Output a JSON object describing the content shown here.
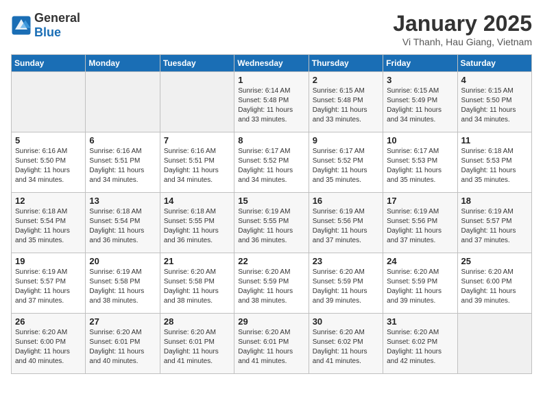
{
  "logo": {
    "general": "General",
    "blue": "Blue"
  },
  "title": "January 2025",
  "location": "Vi Thanh, Hau Giang, Vietnam",
  "weekdays": [
    "Sunday",
    "Monday",
    "Tuesday",
    "Wednesday",
    "Thursday",
    "Friday",
    "Saturday"
  ],
  "weeks": [
    [
      {
        "day": "",
        "info": ""
      },
      {
        "day": "",
        "info": ""
      },
      {
        "day": "",
        "info": ""
      },
      {
        "day": "1",
        "sunrise": "6:14 AM",
        "sunset": "5:48 PM",
        "daylight": "11 hours and 33 minutes."
      },
      {
        "day": "2",
        "sunrise": "6:15 AM",
        "sunset": "5:48 PM",
        "daylight": "11 hours and 33 minutes."
      },
      {
        "day": "3",
        "sunrise": "6:15 AM",
        "sunset": "5:49 PM",
        "daylight": "11 hours and 34 minutes."
      },
      {
        "day": "4",
        "sunrise": "6:15 AM",
        "sunset": "5:50 PM",
        "daylight": "11 hours and 34 minutes."
      }
    ],
    [
      {
        "day": "5",
        "sunrise": "6:16 AM",
        "sunset": "5:50 PM",
        "daylight": "11 hours and 34 minutes."
      },
      {
        "day": "6",
        "sunrise": "6:16 AM",
        "sunset": "5:51 PM",
        "daylight": "11 hours and 34 minutes."
      },
      {
        "day": "7",
        "sunrise": "6:16 AM",
        "sunset": "5:51 PM",
        "daylight": "11 hours and 34 minutes."
      },
      {
        "day": "8",
        "sunrise": "6:17 AM",
        "sunset": "5:52 PM",
        "daylight": "11 hours and 34 minutes."
      },
      {
        "day": "9",
        "sunrise": "6:17 AM",
        "sunset": "5:52 PM",
        "daylight": "11 hours and 35 minutes."
      },
      {
        "day": "10",
        "sunrise": "6:17 AM",
        "sunset": "5:53 PM",
        "daylight": "11 hours and 35 minutes."
      },
      {
        "day": "11",
        "sunrise": "6:18 AM",
        "sunset": "5:53 PM",
        "daylight": "11 hours and 35 minutes."
      }
    ],
    [
      {
        "day": "12",
        "sunrise": "6:18 AM",
        "sunset": "5:54 PM",
        "daylight": "11 hours and 35 minutes."
      },
      {
        "day": "13",
        "sunrise": "6:18 AM",
        "sunset": "5:54 PM",
        "daylight": "11 hours and 36 minutes."
      },
      {
        "day": "14",
        "sunrise": "6:18 AM",
        "sunset": "5:55 PM",
        "daylight": "11 hours and 36 minutes."
      },
      {
        "day": "15",
        "sunrise": "6:19 AM",
        "sunset": "5:55 PM",
        "daylight": "11 hours and 36 minutes."
      },
      {
        "day": "16",
        "sunrise": "6:19 AM",
        "sunset": "5:56 PM",
        "daylight": "11 hours and 37 minutes."
      },
      {
        "day": "17",
        "sunrise": "6:19 AM",
        "sunset": "5:56 PM",
        "daylight": "11 hours and 37 minutes."
      },
      {
        "day": "18",
        "sunrise": "6:19 AM",
        "sunset": "5:57 PM",
        "daylight": "11 hours and 37 minutes."
      }
    ],
    [
      {
        "day": "19",
        "sunrise": "6:19 AM",
        "sunset": "5:57 PM",
        "daylight": "11 hours and 37 minutes."
      },
      {
        "day": "20",
        "sunrise": "6:19 AM",
        "sunset": "5:58 PM",
        "daylight": "11 hours and 38 minutes."
      },
      {
        "day": "21",
        "sunrise": "6:20 AM",
        "sunset": "5:58 PM",
        "daylight": "11 hours and 38 minutes."
      },
      {
        "day": "22",
        "sunrise": "6:20 AM",
        "sunset": "5:59 PM",
        "daylight": "11 hours and 38 minutes."
      },
      {
        "day": "23",
        "sunrise": "6:20 AM",
        "sunset": "5:59 PM",
        "daylight": "11 hours and 39 minutes."
      },
      {
        "day": "24",
        "sunrise": "6:20 AM",
        "sunset": "5:59 PM",
        "daylight": "11 hours and 39 minutes."
      },
      {
        "day": "25",
        "sunrise": "6:20 AM",
        "sunset": "6:00 PM",
        "daylight": "11 hours and 39 minutes."
      }
    ],
    [
      {
        "day": "26",
        "sunrise": "6:20 AM",
        "sunset": "6:00 PM",
        "daylight": "11 hours and 40 minutes."
      },
      {
        "day": "27",
        "sunrise": "6:20 AM",
        "sunset": "6:01 PM",
        "daylight": "11 hours and 40 minutes."
      },
      {
        "day": "28",
        "sunrise": "6:20 AM",
        "sunset": "6:01 PM",
        "daylight": "11 hours and 41 minutes."
      },
      {
        "day": "29",
        "sunrise": "6:20 AM",
        "sunset": "6:01 PM",
        "daylight": "11 hours and 41 minutes."
      },
      {
        "day": "30",
        "sunrise": "6:20 AM",
        "sunset": "6:02 PM",
        "daylight": "11 hours and 41 minutes."
      },
      {
        "day": "31",
        "sunrise": "6:20 AM",
        "sunset": "6:02 PM",
        "daylight": "11 hours and 42 minutes."
      },
      {
        "day": "",
        "info": ""
      }
    ]
  ]
}
